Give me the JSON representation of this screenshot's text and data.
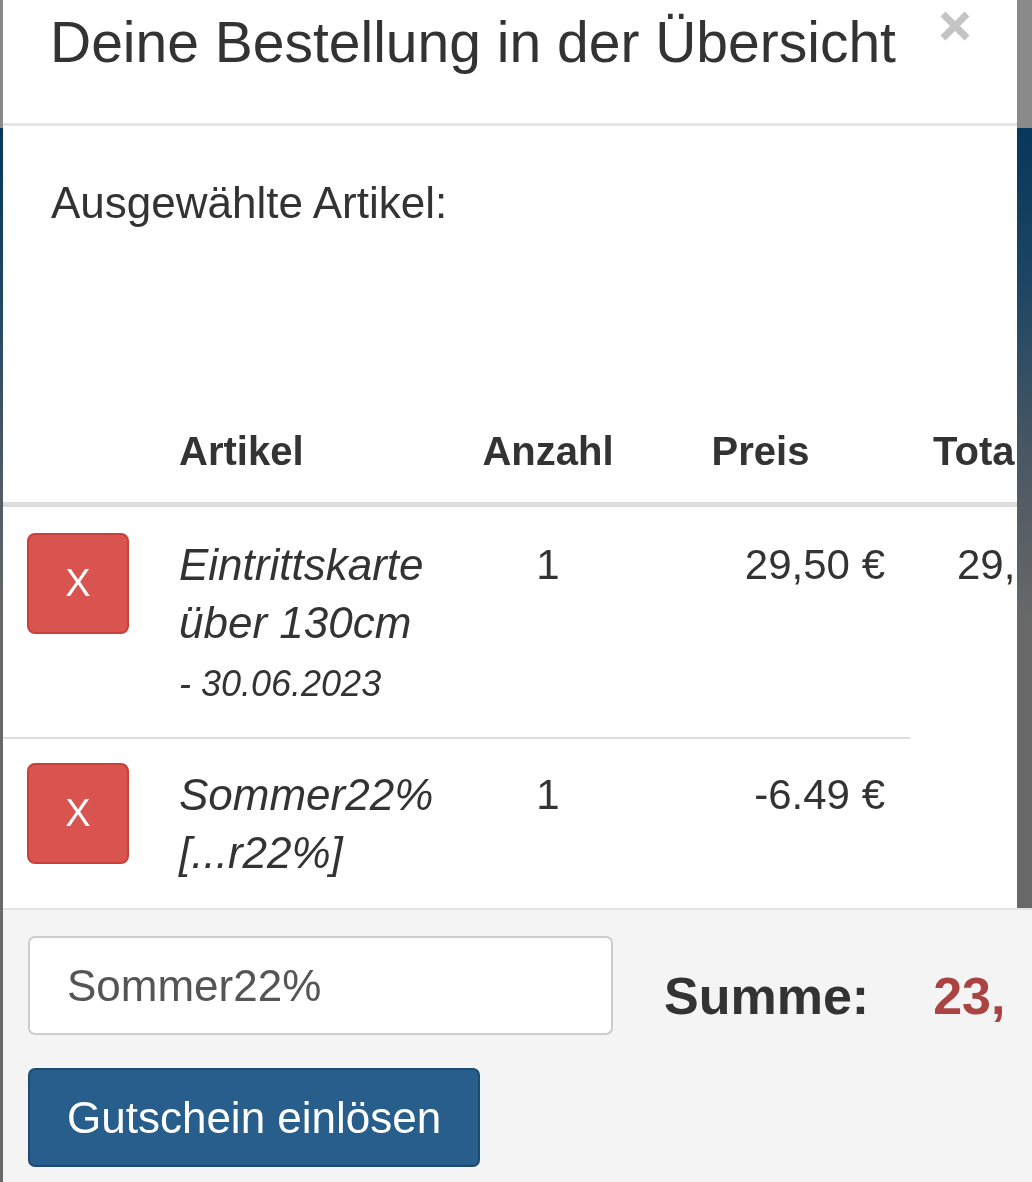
{
  "dialog": {
    "title": "Deine Bestellung in der Übersicht"
  },
  "section_label": "Ausgewählte Artikel:",
  "table": {
    "columns": [
      "Artikel",
      "Anzahl",
      "Preis",
      "Tota"
    ],
    "rows": [
      {
        "remove": "X",
        "item": "Eintrittskarte über 130cm",
        "date": "- 30.06.2023",
        "quantity": "1",
        "price": "29,50 €",
        "total": "29,"
      },
      {
        "remove": "X",
        "item": "Sommer22% [...r22%]",
        "quantity": "1",
        "price": "-6.49 €"
      }
    ]
  },
  "footer": {
    "voucher_field": {
      "value": "Sommer22%"
    },
    "redeem_button": "Gutschein einlösen",
    "sum_label": "Summe:",
    "sum_value": "23,"
  }
}
